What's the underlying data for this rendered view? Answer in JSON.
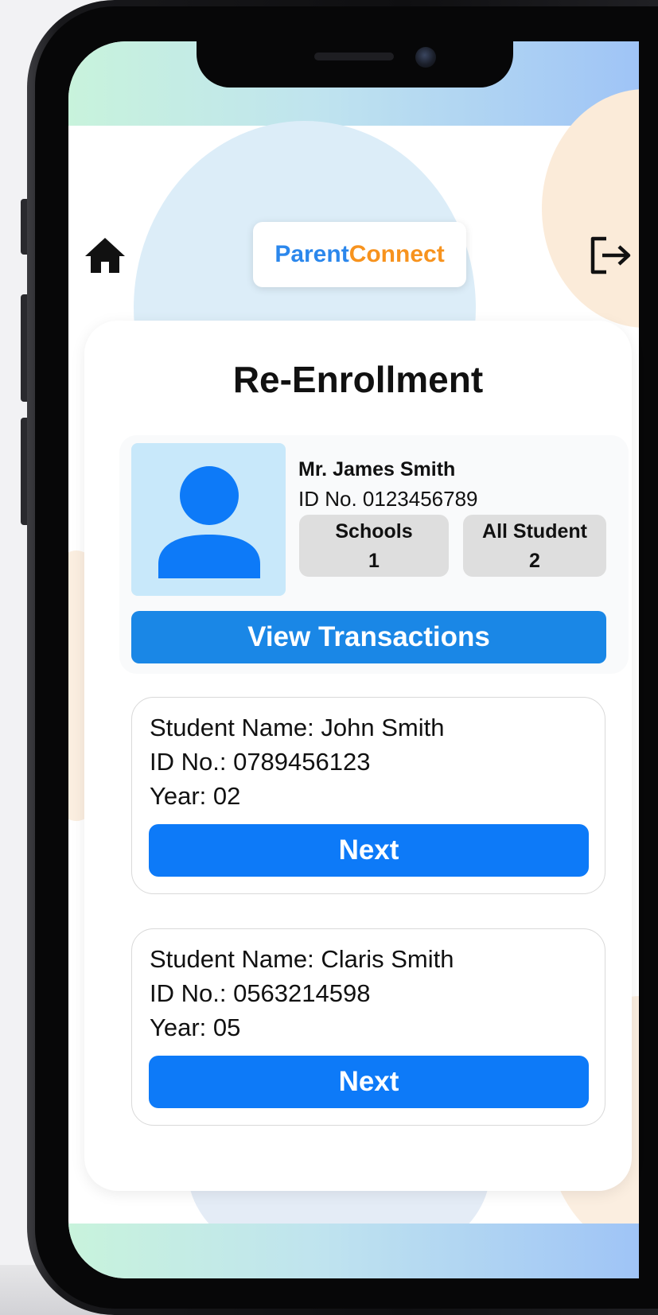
{
  "header": {
    "brand_part1": "Parent",
    "brand_part2": "Connect",
    "home_icon": "home-icon",
    "logout_icon": "logout-icon"
  },
  "page": {
    "title": "Re-Enrollment"
  },
  "profile": {
    "name": "Mr. James Smith",
    "id_line": "ID No. 0123456789",
    "avatar_icon": "user-avatar-icon",
    "stats": [
      {
        "label": "Schools",
        "value": "1"
      },
      {
        "label": "All Student",
        "value": "2"
      }
    ],
    "view_transactions_label": "View Transactions"
  },
  "students": [
    {
      "name_line": "Student Name: John Smith",
      "id_line": "ID No.: 0789456123",
      "year_line": "Year: 02",
      "next_label": "Next"
    },
    {
      "name_line": "Student Name: Claris Smith",
      "id_line": "ID No.: 0563214598",
      "year_line": "Year: 05",
      "next_label": "Next"
    }
  ],
  "colors": {
    "brand_blue": "#2b87ec",
    "brand_orange": "#f7931e",
    "view_button": "#1a87e6",
    "next_button": "#0d7af8",
    "avatar_bg": "#c8e8fa",
    "avatar_fg": "#0d7af8",
    "stat_bg": "#dedede"
  }
}
